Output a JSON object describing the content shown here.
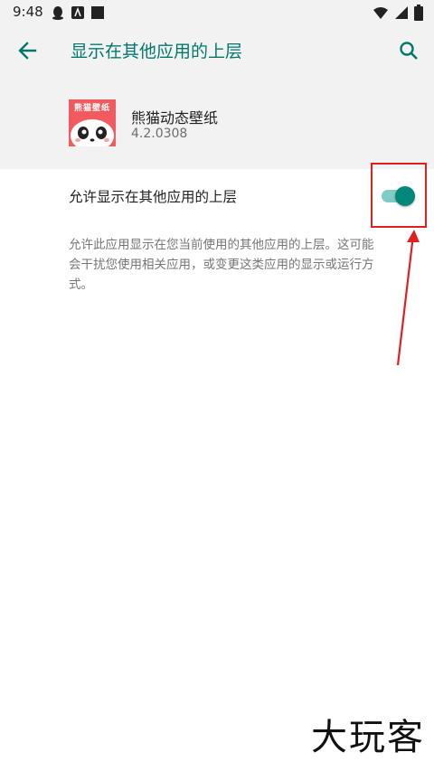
{
  "status_bar": {
    "time": "9:48"
  },
  "app_bar": {
    "title": "显示在其他应用的上层"
  },
  "app": {
    "icon_text": "熊猫壁纸",
    "name": "熊猫动态壁纸",
    "version": "4.2.0308"
  },
  "setting": {
    "label": "允许显示在其他应用的上层",
    "enabled": true,
    "description": "允许此应用显示在您当前使用的其他应用的上层。这可能会干扰您使用相关应用，或变更这类应用的显示或运行方式。"
  },
  "watermark": "大玩客",
  "colors": {
    "accent": "#00796b",
    "toggle_thumb": "#00897b",
    "toggle_track": "#80cbc4",
    "annotation": "#e02020",
    "icon_bg": "#f15a5e"
  }
}
